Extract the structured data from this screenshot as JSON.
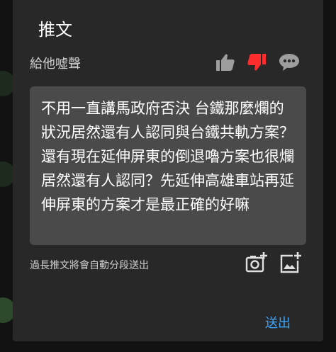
{
  "dialog": {
    "title": "推文",
    "subtitle": "給他噓聲",
    "icons": {
      "like": "thumbs-up-icon",
      "dislike": "thumbs-down-icon",
      "comment": "chat-bubble-icon",
      "camera": "camera-plus-icon",
      "image": "image-plus-icon"
    },
    "colors": {
      "dislike_active": "#ff2d2d",
      "send": "#3ea6ff"
    },
    "input_text": "不用一直講馬政府否決 台鐵那麼爛的狀況居然還有人認同與台鐵共軌方案？還有現在延伸屏東的倒退嚕方案也很爛居然還有人認同？先延伸高雄車站再延伸屏東的方案才是最正確的好嘛",
    "hint": "過長推文將會自動分段送出",
    "send_label": "送出"
  }
}
